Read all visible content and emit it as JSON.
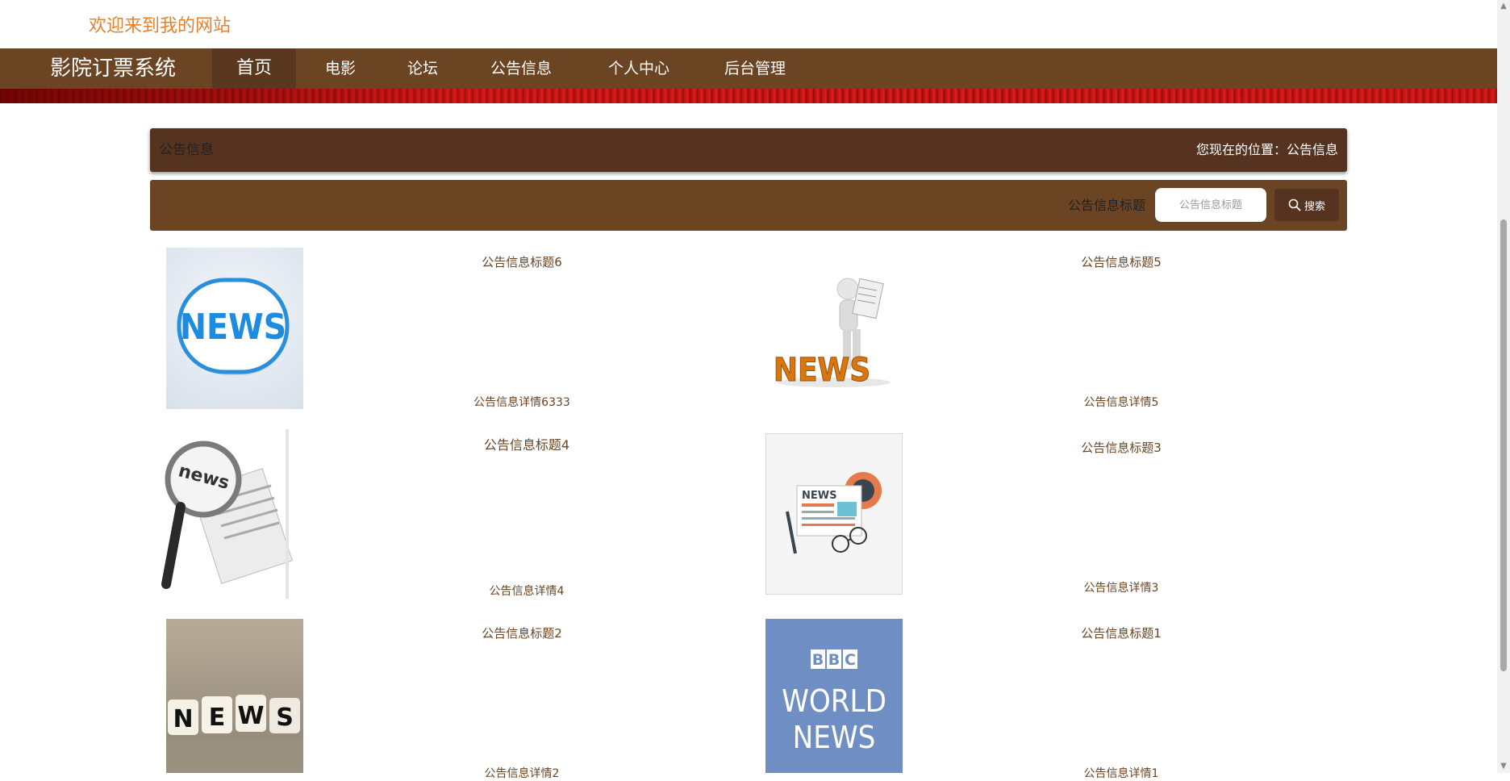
{
  "header": {
    "welcome": "欢迎来到我的网站"
  },
  "nav": {
    "brand": "影院订票系统",
    "items": [
      {
        "label": "首页",
        "active": true
      },
      {
        "label": "电影"
      },
      {
        "label": "论坛"
      },
      {
        "label": "公告信息"
      },
      {
        "label": "个人中心"
      },
      {
        "label": "后台管理"
      }
    ]
  },
  "panel": {
    "title": "公告信息",
    "breadcrumb": "您现在的位置：公告信息"
  },
  "search": {
    "label": "公告信息标题",
    "placeholder": "公告信息标题",
    "button_label": "搜索"
  },
  "news": [
    {
      "title": "公告信息标题6",
      "detail": "公告信息详情6333",
      "image": "news-badge"
    },
    {
      "title": "公告信息标题5",
      "detail": "公告信息详情5",
      "image": "news-3d-man"
    },
    {
      "title": "公告信息标题4",
      "detail": "公告信息详情4",
      "image": "news-magnifier"
    },
    {
      "title": "公告信息标题3",
      "detail": "公告信息详情3",
      "image": "news-paper-glasses"
    },
    {
      "title": "公告信息标题2",
      "detail": "公告信息详情2",
      "image": "news-dice"
    },
    {
      "title": "公告信息标题1",
      "detail": "公告信息详情1",
      "image": "bbc-world-news"
    }
  ],
  "thumb_text": {
    "news": "NEWS",
    "news_lower": "news",
    "dice": [
      "N",
      "E",
      "W",
      "S"
    ],
    "bbc": [
      "B",
      "B",
      "C"
    ],
    "world": "WORLD",
    "news_bbc": "NEWS"
  },
  "colors": {
    "brown": "#6b4423",
    "dark_brown": "#553320",
    "orange": "#e8802b",
    "red_stripe": "#c01515"
  }
}
